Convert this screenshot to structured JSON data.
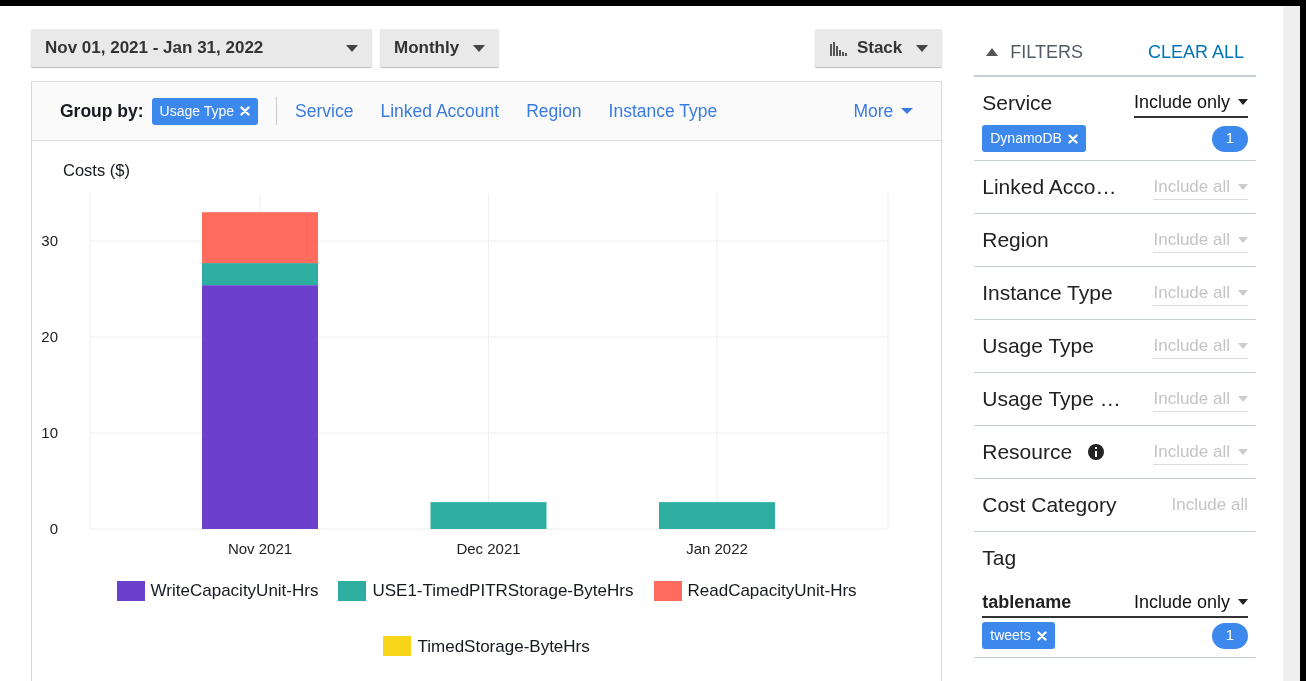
{
  "toolbar": {
    "date_range": "Nov 01, 2021 - Jan 31, 2022",
    "granularity": "Monthly",
    "chart_style": "Stack"
  },
  "group_by": {
    "label": "Group by:",
    "selected_chip": "Usage Type",
    "options": [
      "Service",
      "Linked Account",
      "Region",
      "Instance Type"
    ],
    "more": "More"
  },
  "chart": {
    "chart_data": {
      "type": "bar",
      "ylabel": "Costs ($)",
      "stacked": true,
      "grid": true,
      "categories": [
        "Nov 2021",
        "Dec 2021",
        "Jan 2022"
      ],
      "yticks": [
        0,
        10,
        20,
        30
      ],
      "ylim": [
        0,
        35
      ],
      "series": [
        {
          "name": "WriteCapacityUnit-Hrs",
          "color": "#6b40cc",
          "values": [
            25.4,
            0,
            0
          ]
        },
        {
          "name": "USE1-TimedPITRStorage-ByteHrs",
          "color": "#2eaea0",
          "values": [
            2.3,
            2.8,
            2.8
          ]
        },
        {
          "name": "ReadCapacityUnit-Hrs",
          "color": "#ff6b5d",
          "values": [
            5.3,
            0,
            0
          ]
        },
        {
          "name": "TimedStorage-ByteHrs",
          "color": "#f8d519",
          "values": [
            0,
            0,
            0
          ]
        }
      ]
    }
  },
  "filters": {
    "title": "FILTERS",
    "expanded": true,
    "clear": "CLEAR ALL",
    "items": [
      {
        "label": "Service",
        "mode": "Include only",
        "active": true,
        "dropdown": true,
        "info": false,
        "chips": [
          "DynamoDB"
        ],
        "count": "1"
      },
      {
        "label": "Linked Acco…",
        "mode": "Include all",
        "active": false,
        "dropdown": true,
        "info": false
      },
      {
        "label": "Region",
        "mode": "Include all",
        "active": false,
        "dropdown": true,
        "info": false
      },
      {
        "label": "Instance Type",
        "mode": "Include all",
        "active": false,
        "dropdown": true,
        "info": false
      },
      {
        "label": "Usage Type",
        "mode": "Include all",
        "active": false,
        "dropdown": true,
        "info": false
      },
      {
        "label": "Usage Type …",
        "mode": "Include all",
        "active": false,
        "dropdown": true,
        "info": false
      },
      {
        "label": "Resource",
        "mode": "Include all",
        "active": false,
        "dropdown": true,
        "info": true
      },
      {
        "label": "Cost Category",
        "mode": "Include all",
        "active": false,
        "dropdown": false,
        "info": false
      },
      {
        "label": "Tag",
        "children": [
          {
            "label": "tablename",
            "mode": "Include only",
            "active": true,
            "dropdown": true,
            "info": false,
            "chips": [
              "tweets"
            ],
            "count": "1"
          }
        ]
      }
    ]
  }
}
